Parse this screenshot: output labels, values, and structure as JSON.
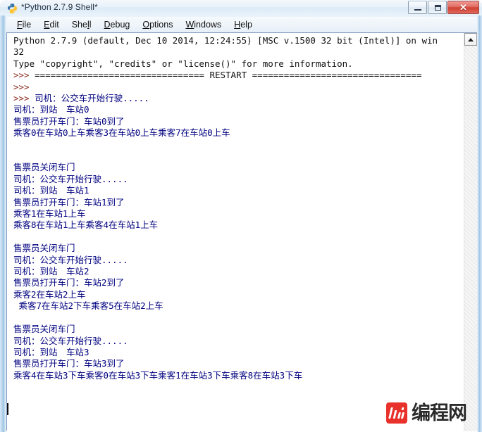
{
  "window": {
    "title": "*Python 2.7.9 Shell*",
    "icon": "python-idle-icon",
    "controls": {
      "minimize_label": "",
      "maximize_label": "",
      "close_label": "✕"
    }
  },
  "menubar": {
    "items": [
      {
        "label": "File",
        "accel": "F"
      },
      {
        "label": "Edit",
        "accel": "E"
      },
      {
        "label": "Shell",
        "accel": "l"
      },
      {
        "label": "Debug",
        "accel": "D"
      },
      {
        "label": "Options",
        "accel": "O"
      },
      {
        "label": "Windows",
        "accel": "W"
      },
      {
        "label": "Help",
        "accel": "H"
      }
    ]
  },
  "console": {
    "lines": [
      {
        "text": "Python 2.7.9 (default, Dec 10 2014, 12:24:55) [MSC v.1500 32 bit (Intel)] on win",
        "style": "black"
      },
      {
        "text": "32",
        "style": "black"
      },
      {
        "text": "Type \"copyright\", \"credits\" or \"license()\" for more information.",
        "style": "black"
      },
      {
        "text": ">>> ================================ RESTART ================================",
        "style": "prompt-black"
      },
      {
        "text": ">>> ",
        "style": "prompt-black"
      },
      {
        "text": ">>> 司机：公交车开始行驶.....",
        "style": "prompt-blue"
      },
      {
        "text": "司机：到站　车站0",
        "style": "blue"
      },
      {
        "text": "售票员打开车门：车站0到了",
        "style": "blue"
      },
      {
        "text": "乘客0在车站0上车乘客3在车站0上车乘客7在车站0上车",
        "style": "blue"
      },
      {
        "text": "",
        "style": "blue"
      },
      {
        "text": "",
        "style": "blue"
      },
      {
        "text": "售票员关闭车门",
        "style": "blue"
      },
      {
        "text": "司机：公交车开始行驶.....",
        "style": "blue"
      },
      {
        "text": "司机：到站　车站1",
        "style": "blue"
      },
      {
        "text": "售票员打开车门：车站1到了",
        "style": "blue"
      },
      {
        "text": "乘客1在车站1上车",
        "style": "blue"
      },
      {
        "text": "乘客8在车站1上车乘客4在车站1上车",
        "style": "blue"
      },
      {
        "text": "",
        "style": "blue"
      },
      {
        "text": "售票员关闭车门",
        "style": "blue"
      },
      {
        "text": "司机：公交车开始行驶.....",
        "style": "blue"
      },
      {
        "text": "司机：到站　车站2",
        "style": "blue"
      },
      {
        "text": "售票员打开车门：车站2到了",
        "style": "blue"
      },
      {
        "text": "乘客2在车站2上车",
        "style": "blue"
      },
      {
        "text": " 乘客7在车站2下车乘客5在车站2上车",
        "style": "blue"
      },
      {
        "text": "",
        "style": "blue"
      },
      {
        "text": "售票员关闭车门",
        "style": "blue"
      },
      {
        "text": "司机：公交车开始行驶.....",
        "style": "blue"
      },
      {
        "text": "司机：到站　车站3",
        "style": "blue"
      },
      {
        "text": "售票员打开车门：车站3到了",
        "style": "blue"
      },
      {
        "text": "乘客4在车站3下车乘客0在车站3下车乘客1在车站3下车乘客8在车站3下车",
        "style": "blue"
      }
    ]
  },
  "scrollbar": {
    "up_arrow": "scroll-up-arrow"
  },
  "watermark": {
    "text": "编程网"
  },
  "colors": {
    "stdout_blue": "#000080",
    "prompt_maroon": "#8b2b1f",
    "text_black": "#101010",
    "watermark_red": "#e8312a"
  }
}
